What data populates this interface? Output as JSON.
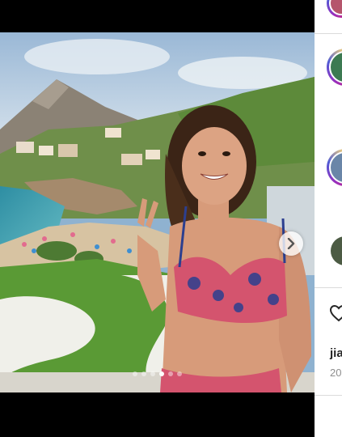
{
  "post": {
    "carousel": {
      "slide_count": 6,
      "active_index": 3
    },
    "next_icon": "chevron-right-icon"
  },
  "side": {
    "username": "jia",
    "date": "20"
  },
  "colors": {
    "background": "#000000",
    "panel": "#ffffff",
    "story_ring": [
      "#feda75",
      "#fa7e1e",
      "#d62976",
      "#962fbf",
      "#4f5bd5"
    ]
  }
}
